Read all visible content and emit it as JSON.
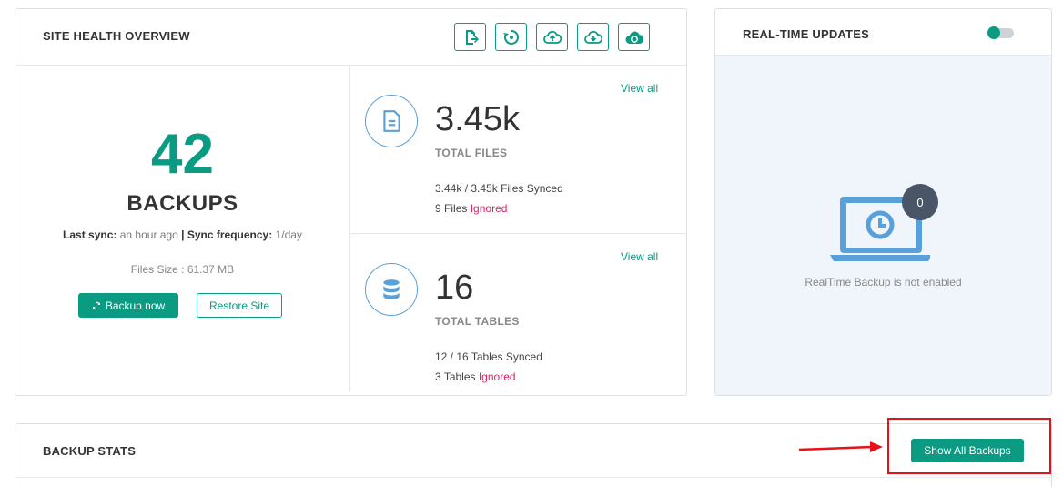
{
  "site_health": {
    "title": "SITE HEALTH OVERVIEW",
    "backups": {
      "count": "42",
      "label": "BACKUPS",
      "last_sync_label": "Last sync:",
      "last_sync_value": "an hour ago",
      "separator": "|",
      "sync_freq_label": "Sync frequency:",
      "sync_freq_value": "1/day",
      "files_size": "Files Size : 61.37 MB",
      "backup_now_label": "Backup now",
      "restore_label": "Restore Site"
    },
    "files": {
      "view_all": "View all",
      "value": "3.45k",
      "label": "TOTAL FILES",
      "synced_count": "3.44k / 3.45k",
      "synced_text": "Files Synced",
      "ignored_count": "9",
      "ignored_prefix": "Files",
      "ignored_text": "Ignored"
    },
    "tables": {
      "view_all": "View all",
      "value": "16",
      "label": "TOTAL TABLES",
      "synced_count": "12 / 16",
      "synced_text": "Tables Synced",
      "ignored_count": "3",
      "ignored_prefix": "Tables",
      "ignored_text": "Ignored"
    },
    "toolbar_icons": [
      "file-export-icon",
      "restore-icon",
      "cloud-upload-icon",
      "cloud-download-icon",
      "cloud-sync-icon"
    ]
  },
  "realtime": {
    "title": "REAL-TIME UPDATES",
    "toggle_on": false,
    "badge": "0",
    "caption": "RealTime Backup is not enabled"
  },
  "backup_stats": {
    "title": "BACKUP STATS",
    "show_all_label": "Show All Backups"
  },
  "colors": {
    "accent": "#0b9a82",
    "ignored": "#e0245e",
    "icon_blue": "#5aa0d8",
    "highlight": "#e8101a"
  }
}
